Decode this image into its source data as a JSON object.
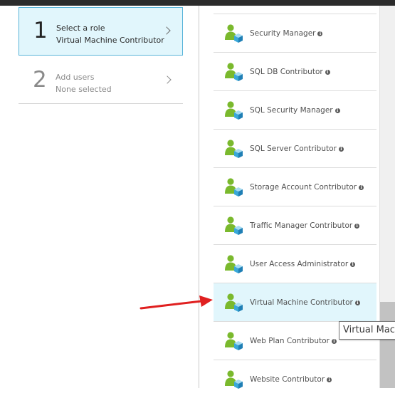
{
  "wizard": {
    "steps": [
      {
        "number": "1",
        "title": "Select a role",
        "subtitle": "Virtual Machine Contributor",
        "active": true
      },
      {
        "number": "2",
        "title": "Add users",
        "subtitle": "None selected",
        "active": false
      }
    ]
  },
  "roles": {
    "items": [
      {
        "label": "Security Manager"
      },
      {
        "label": "SQL DB Contributor"
      },
      {
        "label": "SQL Security Manager"
      },
      {
        "label": "SQL Server Contributor"
      },
      {
        "label": "Storage Account Contributor"
      },
      {
        "label": "Traffic Manager Contributor"
      },
      {
        "label": "User Access Administrator"
      },
      {
        "label": "Virtual Machine Contributor",
        "selected": true
      },
      {
        "label": "Web Plan Contributor"
      },
      {
        "label": "Website Contributor"
      }
    ],
    "info_glyph": "i"
  },
  "tooltip": {
    "text": "Virtual Mac"
  },
  "colors": {
    "selected_bg": "#e1f6fc",
    "selected_border": "#59b4d9",
    "annotation_arrow": "#e02020",
    "role_icon_green": "#7ab92d",
    "role_icon_blue": "#3aa8d8"
  },
  "icons": {
    "role": "user-role-icon",
    "info": "info-icon",
    "chevron": "chevron-right-icon",
    "annotation": "red-arrow-annotation"
  }
}
